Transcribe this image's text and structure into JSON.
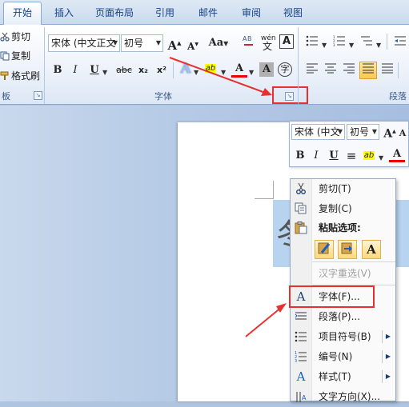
{
  "tabs": [
    {
      "label": "开始",
      "active": true
    },
    {
      "label": "插入"
    },
    {
      "label": "页面布局"
    },
    {
      "label": "引用"
    },
    {
      "label": "邮件"
    },
    {
      "label": "审阅"
    },
    {
      "label": "视图"
    }
  ],
  "clipboard": {
    "cut": "剪切",
    "copy": "复制",
    "format_painter": "格式刷",
    "group_label": "板"
  },
  "font_group": {
    "font_name": "宋体 (中文正文",
    "font_size": "初号",
    "grow": "A",
    "shrink": "A",
    "case": "Aa",
    "wen": "wén",
    "border_char": "A",
    "bold": "B",
    "italic": "I",
    "underline": "U",
    "strike": "abc",
    "subscript": "x₂",
    "superscript": "x²",
    "highlight": "ab",
    "font_color": "A",
    "shading": "A",
    "enclose": "字",
    "group_label": "字体"
  },
  "paragraph_group": {
    "group_label": "段落"
  },
  "mini_toolbar": {
    "font_name": "宋体 (中文",
    "font_size": "初号",
    "grow": "A",
    "shrink": "A",
    "bold": "B",
    "italic": "I",
    "underline": "U",
    "center": "≡",
    "highlight": "ab",
    "font_color": "A"
  },
  "document": {
    "selected_text": "冬 〜"
  },
  "context_menu": {
    "items": [
      {
        "label": "剪切(T)",
        "icon": "scissors-icon"
      },
      {
        "label": "复制(C)",
        "icon": "copy-icon"
      },
      {
        "label": "粘贴选项:",
        "icon": "paste-icon"
      },
      {
        "label": "汉字重选(V)",
        "disabled": true
      },
      {
        "label": "字体(F)...",
        "icon": "font-icon"
      },
      {
        "label": "段落(P)...",
        "icon": "paragraph-icon"
      },
      {
        "label": "项目符号(B)",
        "icon": "bullets-icon",
        "submenu": true
      },
      {
        "label": "编号(N)",
        "icon": "numbering-icon",
        "submenu": true
      },
      {
        "label": "样式(T)",
        "icon": "styles-icon",
        "submenu": true
      },
      {
        "label": "文字方向(X)...",
        "icon": "text-direction-icon"
      }
    ]
  },
  "colors": {
    "highlight_box": "#e8312f",
    "accent": "#15428b",
    "selection": "#b8d3ef"
  }
}
